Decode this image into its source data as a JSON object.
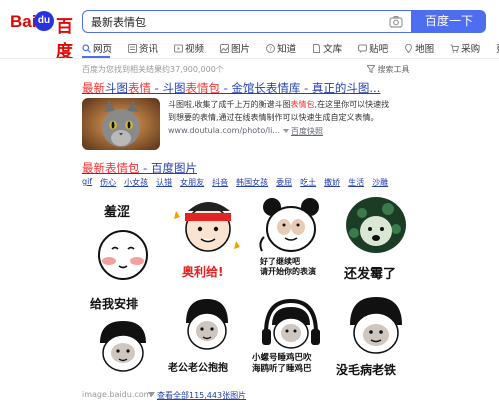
{
  "header": {
    "logo_left": "Bai",
    "logo_mark": "du",
    "logo_right": "百度",
    "search_value": "最新表情包",
    "search_button": "百度一下"
  },
  "tabs": [
    {
      "label": "网页",
      "icon": "search-icon"
    },
    {
      "label": "资讯",
      "icon": "news-icon"
    },
    {
      "label": "视频",
      "icon": "video-icon"
    },
    {
      "label": "图片",
      "icon": "image-icon"
    },
    {
      "label": "知道",
      "icon": "question-icon"
    },
    {
      "label": "文库",
      "icon": "doc-icon"
    },
    {
      "label": "贴吧",
      "icon": "forum-icon"
    },
    {
      "label": "地图",
      "icon": "map-icon"
    },
    {
      "label": "采购",
      "icon": "cart-icon"
    },
    {
      "label": "更多",
      "icon": ""
    }
  ],
  "stats": "百度为您找到相关结果约37,900,000个",
  "search_tools": "搜索工具",
  "result1": {
    "title_a": "最新",
    "title_b": "斗图",
    "title_c": "表情",
    "title_d": " - ",
    "title_e": "斗图",
    "title_f": "表情包",
    "title_g": " - 金馆长表情库 - 真正的斗图...",
    "snippet_a": "斗图啦,收集了成千上万的衡谱斗图",
    "snippet_b": "表情包",
    "snippet_c": ",在这里你可以快速找到想要的表情,通过在线表情制作可以快速生成自定义表情。",
    "url": "www.doutula.com/photo/li...",
    "snapshot": "百度快照"
  },
  "result2": {
    "title_a": "最新表情包",
    "title_b": " - 百度图片",
    "tags": [
      "gif",
      "伤心",
      "小女孩",
      "认错",
      "女朋友",
      "抖音",
      "韩国女孩",
      "委屈",
      "吃土",
      "撒娇",
      "生活",
      "沙雕"
    ],
    "captions": [
      "羞涩",
      "奥利给!",
      "好了继续吧\n请开始你的表演",
      "还发霉了",
      "给我安排",
      "老公老公抱抱",
      "小螺号睡鸡巴吹\n海鸥听了睡鸡巴",
      "没毛病老铁"
    ],
    "source": "image.baidu.com",
    "view_all": "查看全部115,443张图片"
  },
  "colors": {
    "brand_blue": "#4e6ef2",
    "brand_red": "#e10602",
    "link": "#2440b3",
    "highlight": "#f73131"
  }
}
